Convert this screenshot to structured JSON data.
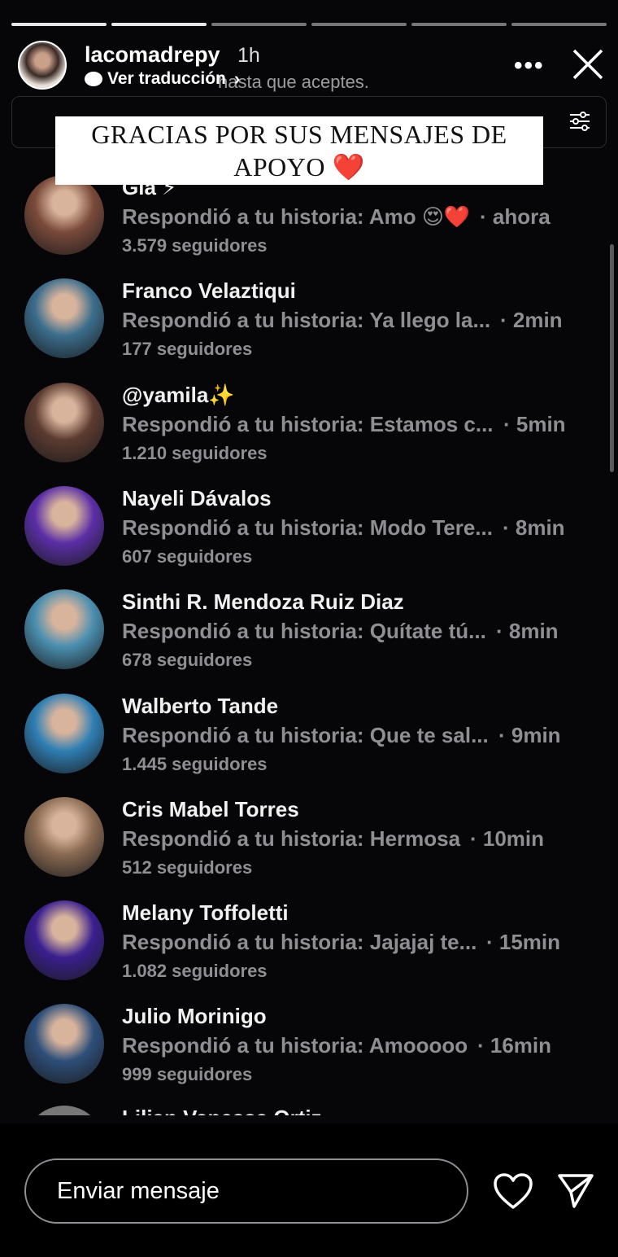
{
  "story": {
    "username": "lacomadrepy",
    "time_ago": "1h",
    "translate_label": "Ver traducción",
    "translate_chevron": "›",
    "overlay_text": "hasta que aceptes.",
    "more_label": "•••",
    "caption_line1": "GRACIAS POR SUS MENSAJES DE",
    "caption_line2": "APOYO",
    "caption_heart": "❤️"
  },
  "replies": [
    {
      "name": "Gia ⚡",
      "reply": "Respondió a tu historia: Amo 😍❤️",
      "time": "· ahora",
      "followers": "3.579 seguidores",
      "avatar_color": "#7a4a3a"
    },
    {
      "name": "Franco Velaztiqui",
      "reply": "Respondió a tu historia: Ya llego la...",
      "time": "· 2min",
      "followers": "177 seguidores",
      "avatar_color": "#3b6d8c"
    },
    {
      "name": "@yamila✨",
      "reply": "Respondió a tu historia: Estamos c...",
      "time": "· 5min",
      "followers": "1.210 seguidores",
      "avatar_color": "#5c3b30"
    },
    {
      "name": "Nayeli Dávalos",
      "reply": "Respondió a tu historia: Modo Tere...",
      "time": "· 8min",
      "followers": "607 seguidores",
      "avatar_color": "#5b2ea6"
    },
    {
      "name": "Sinthi R. Mendoza Ruiz Diaz",
      "reply": "Respondió a tu historia: Quítate tú...",
      "time": "· 8min",
      "followers": "678 seguidores",
      "avatar_color": "#4a8fb0"
    },
    {
      "name": "Walberto Tande",
      "reply": "Respondió a tu historia: Que te sal...",
      "time": "· 9min",
      "followers": "1.445 seguidores",
      "avatar_color": "#2f7fb4"
    },
    {
      "name": "Cris Mabel Torres",
      "reply": "Respondió a tu historia: Hermosa",
      "time": "· 10min",
      "followers": "512 seguidores",
      "avatar_color": "#8a6a52"
    },
    {
      "name": "Melany Toffoletti",
      "reply": "Respondió a tu historia: Jajajaj te...",
      "time": "· 15min",
      "followers": "1.082 seguidores",
      "avatar_color": "#3a1f8f"
    },
    {
      "name": "Julio Morinigo",
      "reply": "Respondió a tu historia: Amooooo",
      "time": "· 16min",
      "followers": "999 seguidores",
      "avatar_color": "#2e4f7a"
    }
  ],
  "partial_row": {
    "name": "Lilian Vanessa Ortiz"
  },
  "footer": {
    "message_placeholder": "Enviar mensaje"
  },
  "colors": {
    "background": "#000000",
    "muted_text": "#8e8e93",
    "heart_red": "#e0202f"
  }
}
